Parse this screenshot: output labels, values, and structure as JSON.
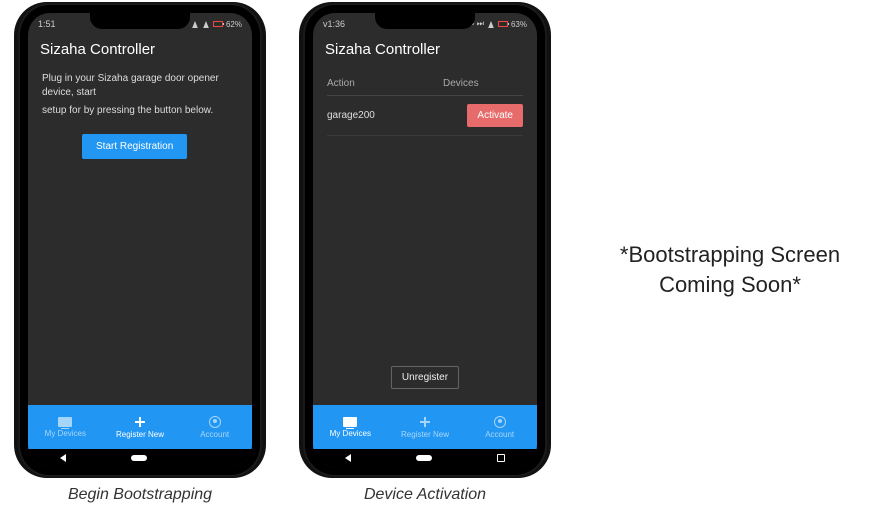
{
  "phone1": {
    "status_time": "1:51",
    "status_batt": "62%",
    "app_title": "Sizaha Controller",
    "instruction_line1": "Plug in your Sizaha garage door opener device, start",
    "instruction_line2": "setup for by pressing the button below.",
    "start_button": "Start Registration",
    "nav": {
      "my_devices": "My Devices",
      "register_new": "Register New",
      "account": "Account"
    },
    "caption": "Begin Bootstrapping"
  },
  "phone2": {
    "status_time": "v1:36",
    "status_batt": "63%",
    "app_title": "Sizaha Controller",
    "col_action": "Action",
    "col_devices": "Devices",
    "row_device": "garage200",
    "activate_button": "Activate",
    "unregister_button": "Unregister",
    "nav": {
      "my_devices": "My Devices",
      "register_new": "Register New",
      "account": "Account"
    },
    "caption": "Device Activation"
  },
  "placeholder": {
    "line1": "*Bootstrapping Screen",
    "line2": "Coming Soon*"
  }
}
